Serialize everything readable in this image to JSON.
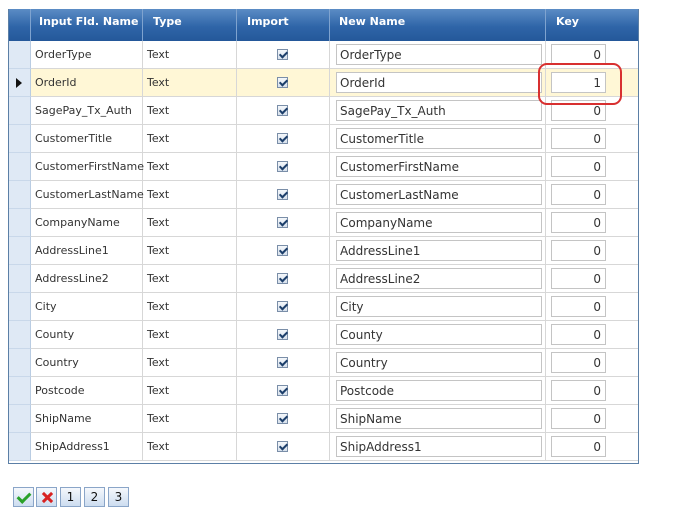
{
  "columns": {
    "input_fld_name": "Input Fld. Name",
    "type": "Type",
    "import": "Import",
    "new_name": "New Name",
    "key": "Key"
  },
  "rows": [
    {
      "input": "OrderType",
      "type": "Text",
      "import": true,
      "new_name": "OrderType",
      "key": "0",
      "selected": false
    },
    {
      "input": "OrderId",
      "type": "Text",
      "import": true,
      "new_name": "OrderId",
      "key": "1",
      "selected": true
    },
    {
      "input": "SagePay_Tx_Auth",
      "type": "Text",
      "import": true,
      "new_name": "SagePay_Tx_Auth",
      "key": "0",
      "selected": false
    },
    {
      "input": "CustomerTitle",
      "type": "Text",
      "import": true,
      "new_name": "CustomerTitle",
      "key": "0",
      "selected": false
    },
    {
      "input": "CustomerFirstName",
      "type": "Text",
      "import": true,
      "new_name": "CustomerFirstName",
      "key": "0",
      "selected": false
    },
    {
      "input": "CustomerLastName",
      "type": "Text",
      "import": true,
      "new_name": "CustomerLastName",
      "key": "0",
      "selected": false
    },
    {
      "input": "CompanyName",
      "type": "Text",
      "import": true,
      "new_name": "CompanyName",
      "key": "0",
      "selected": false
    },
    {
      "input": "AddressLine1",
      "type": "Text",
      "import": true,
      "new_name": "AddressLine1",
      "key": "0",
      "selected": false
    },
    {
      "input": "AddressLine2",
      "type": "Text",
      "import": true,
      "new_name": "AddressLine2",
      "key": "0",
      "selected": false
    },
    {
      "input": "City",
      "type": "Text",
      "import": true,
      "new_name": "City",
      "key": "0",
      "selected": false
    },
    {
      "input": "County",
      "type": "Text",
      "import": true,
      "new_name": "County",
      "key": "0",
      "selected": false
    },
    {
      "input": "Country",
      "type": "Text",
      "import": true,
      "new_name": "Country",
      "key": "0",
      "selected": false
    },
    {
      "input": "Postcode",
      "type": "Text",
      "import": true,
      "new_name": "Postcode",
      "key": "0",
      "selected": false
    },
    {
      "input": "ShipName",
      "type": "Text",
      "import": true,
      "new_name": "ShipName",
      "key": "0",
      "selected": false
    },
    {
      "input": "ShipAddress1",
      "type": "Text",
      "import": true,
      "new_name": "ShipAddress1",
      "key": "0",
      "selected": false
    }
  ],
  "toolbar": {
    "confirm_icon": "checkmark-icon",
    "cancel_icon": "cross-icon",
    "buttons": [
      "1",
      "2",
      "3"
    ]
  },
  "colors": {
    "header": "#2f65a8",
    "selected_row": "#fff7d6",
    "highlight": "#d83030"
  }
}
